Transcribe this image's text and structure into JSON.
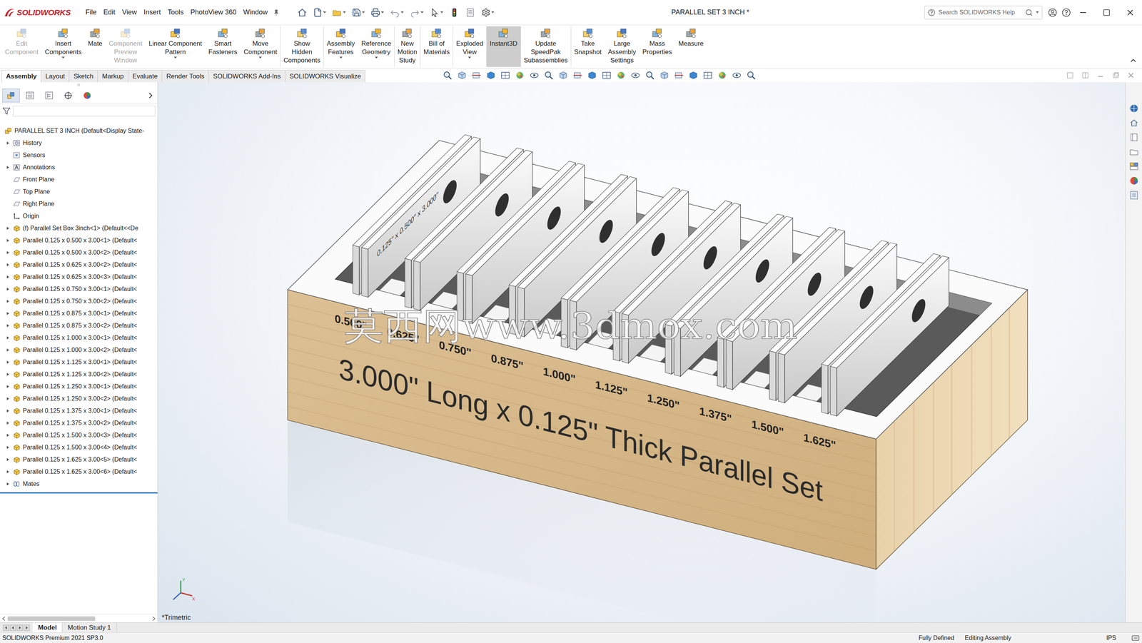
{
  "window": {
    "app": "SOLIDWORKS",
    "title": "PARALLEL SET 3 INCH *"
  },
  "menu": [
    "File",
    "Edit",
    "View",
    "Insert",
    "Tools",
    "PhotoView 360",
    "Window"
  ],
  "search": {
    "placeholder": "Search SOLIDWORKS Help"
  },
  "ribbon": [
    {
      "lines": [
        "Edit",
        "Component"
      ],
      "disabled": true,
      "selected": false,
      "divider": false,
      "dropdown": false
    },
    {
      "lines": [
        "Insert",
        "Components"
      ],
      "disabled": false,
      "selected": false,
      "divider": false,
      "dropdown": true
    },
    {
      "lines": [
        "Mate"
      ],
      "disabled": false,
      "selected": false,
      "divider": false,
      "dropdown": false
    },
    {
      "lines": [
        "Component",
        "Preview",
        "Window"
      ],
      "disabled": true,
      "selected": false,
      "divider": false,
      "dropdown": false
    },
    {
      "lines": [
        "Linear Component",
        "Pattern"
      ],
      "disabled": false,
      "selected": false,
      "divider": false,
      "dropdown": true
    },
    {
      "lines": [
        "Smart",
        "Fasteners"
      ],
      "disabled": false,
      "selected": false,
      "divider": false,
      "dropdown": false
    },
    {
      "lines": [
        "Move",
        "Component"
      ],
      "disabled": false,
      "selected": false,
      "divider": false,
      "dropdown": true
    },
    {
      "lines": [
        "Show",
        "Hidden",
        "Components"
      ],
      "disabled": false,
      "selected": false,
      "divider": true,
      "dropdown": false
    },
    {
      "lines": [
        "Assembly",
        "Features"
      ],
      "disabled": false,
      "selected": false,
      "divider": true,
      "dropdown": true
    },
    {
      "lines": [
        "Reference",
        "Geometry"
      ],
      "disabled": false,
      "selected": false,
      "divider": false,
      "dropdown": true
    },
    {
      "lines": [
        "New",
        "Motion",
        "Study"
      ],
      "disabled": false,
      "selected": false,
      "divider": true,
      "dropdown": false
    },
    {
      "lines": [
        "Bill of",
        "Materials"
      ],
      "disabled": false,
      "selected": false,
      "divider": true,
      "dropdown": false
    },
    {
      "lines": [
        "Exploded",
        "View"
      ],
      "disabled": false,
      "selected": false,
      "divider": true,
      "dropdown": true
    },
    {
      "lines": [
        "Instant3D"
      ],
      "disabled": false,
      "selected": true,
      "divider": true,
      "dropdown": false
    },
    {
      "lines": [
        "Update",
        "SpeedPak",
        "Subassemblies"
      ],
      "disabled": false,
      "selected": false,
      "divider": true,
      "dropdown": false
    },
    {
      "lines": [
        "Take",
        "Snapshot"
      ],
      "disabled": false,
      "selected": false,
      "divider": true,
      "dropdown": false
    },
    {
      "lines": [
        "Large",
        "Assembly",
        "Settings"
      ],
      "disabled": false,
      "selected": false,
      "divider": false,
      "dropdown": false
    },
    {
      "lines": [
        "Mass",
        "Properties"
      ],
      "disabled": false,
      "selected": false,
      "divider": false,
      "dropdown": false
    },
    {
      "lines": [
        "Measure"
      ],
      "disabled": false,
      "selected": false,
      "divider": false,
      "dropdown": false
    }
  ],
  "tabs": [
    {
      "label": "Assembly",
      "selected": true
    },
    {
      "label": "Layout",
      "selected": false
    },
    {
      "label": "Sketch",
      "selected": false
    },
    {
      "label": "Markup",
      "selected": false
    },
    {
      "label": "Evaluate",
      "selected": false
    },
    {
      "label": "Render Tools",
      "selected": false
    },
    {
      "label": "SOLIDWORKS Add-Ins",
      "selected": false
    },
    {
      "label": "SOLIDWORKS Visualize",
      "selected": false
    }
  ],
  "panel_tabs": [
    {
      "kind": "feature-manager",
      "selected": true
    },
    {
      "kind": "property-manager",
      "selected": false
    },
    {
      "kind": "configuration-manager",
      "selected": false
    },
    {
      "kind": "dimxpert-manager",
      "selected": false
    },
    {
      "kind": "display-manager",
      "selected": false
    }
  ],
  "tree": {
    "root": "PARALLEL SET 3 INCH  (Default<Display State-",
    "items": [
      {
        "label": "History",
        "kind": "history",
        "expandable": true
      },
      {
        "label": "Sensors",
        "kind": "sensors",
        "expandable": false
      },
      {
        "label": "Annotations",
        "kind": "annotations",
        "expandable": true
      },
      {
        "label": "Front Plane",
        "kind": "plane",
        "expandable": false
      },
      {
        "label": "Top Plane",
        "kind": "plane",
        "expandable": false
      },
      {
        "label": "Right Plane",
        "kind": "plane",
        "expandable": false
      },
      {
        "label": "Origin",
        "kind": "origin",
        "expandable": false
      },
      {
        "label": "(f) Parallel Set Box 3inch<1> (Default<<De",
        "kind": "part",
        "expandable": true
      },
      {
        "label": "Parallel 0.125 x 0.500 x 3.00<1> (Default<",
        "kind": "part",
        "expandable": true
      },
      {
        "label": "Parallel 0.125 x 0.500 x 3.00<2> (Default<",
        "kind": "part",
        "expandable": true
      },
      {
        "label": "Parallel 0.125 x 0.625 x 3.00<2> (Default<",
        "kind": "part",
        "expandable": true
      },
      {
        "label": "Parallel 0.125 x 0.625 x 3.00<3> (Default<",
        "kind": "part",
        "expandable": true
      },
      {
        "label": "Parallel 0.125 x 0.750 x 3.00<1> (Default<",
        "kind": "part",
        "expandable": true
      },
      {
        "label": "Parallel 0.125 x 0.750 x 3.00<2> (Default<",
        "kind": "part",
        "expandable": true
      },
      {
        "label": "Parallel 0.125 x 0.875 x 3.00<1> (Default<",
        "kind": "part",
        "expandable": true
      },
      {
        "label": "Parallel 0.125 x 0.875 x 3.00<2> (Default<",
        "kind": "part",
        "expandable": true
      },
      {
        "label": "Parallel 0.125 x 1.000 x 3.00<1> (Default<",
        "kind": "part",
        "expandable": true
      },
      {
        "label": "Parallel 0.125 x 1.000 x 3.00<2> (Default<",
        "kind": "part",
        "expandable": true
      },
      {
        "label": "Parallel 0.125 x 1.125 x 3.00<1> (Default<",
        "kind": "part",
        "expandable": true
      },
      {
        "label": "Parallel 0.125 x 1.125 x 3.00<2> (Default<",
        "kind": "part",
        "expandable": true
      },
      {
        "label": "Parallel 0.125 x 1.250 x 3.00<1> (Default<",
        "kind": "part",
        "expandable": true
      },
      {
        "label": "Parallel 0.125 x 1.250 x 3.00<2> (Default<",
        "kind": "part",
        "expandable": true
      },
      {
        "label": "Parallel 0.125 x 1.375 x 3.00<1> (Default<",
        "kind": "part",
        "expandable": true
      },
      {
        "label": "Parallel 0.125 x 1.375 x 3.00<2> (Default<",
        "kind": "part",
        "expandable": true
      },
      {
        "label": "Parallel 0.125 x 1.500 x 3.00<3> (Default<",
        "kind": "part",
        "expandable": true
      },
      {
        "label": "Parallel 0.125 x 1.500 x 3.00<4> (Default<",
        "kind": "part",
        "expandable": true
      },
      {
        "label": "Parallel 0.125 x 1.625 x 3.00<5> (Default<",
        "kind": "part",
        "expandable": true
      },
      {
        "label": "Parallel 0.125 x 1.625 x 3.00<6> (Default<",
        "kind": "part",
        "expandable": true
      },
      {
        "label": "Mates",
        "kind": "mates",
        "expandable": true
      }
    ]
  },
  "model": {
    "title": "3.000\" Long x 0.125\" Thick Parallel Set",
    "sizes": [
      "0.500\"",
      "0.625\"",
      "0.750\"",
      "0.875\"",
      "1.000\"",
      "1.125\"",
      "1.250\"",
      "1.375\"",
      "1.500\"",
      "1.625\""
    ],
    "plate_label": "0.125\" x 0.500\" x 3.000\"",
    "watermark": "莫西网www.3dmox.com"
  },
  "view": {
    "orientation": "*Trimetric",
    "axes": [
      "Y",
      "X"
    ]
  },
  "bottom_tabs": [
    {
      "label": "Model",
      "selected": true
    },
    {
      "label": "Motion Study 1",
      "selected": false
    }
  ],
  "status_bar": {
    "product": "SOLIDWORKS Premium 2021 SP3.0",
    "fields": [
      "Fully Defined",
      "Editing Assembly",
      "IPS"
    ]
  }
}
